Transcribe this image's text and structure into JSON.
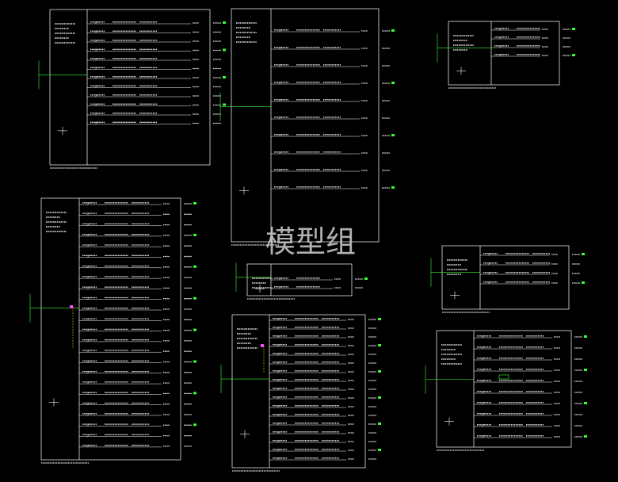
{
  "watermark": "模型组",
  "colors": {
    "background": "#000000",
    "frame": "#ffffff",
    "wire": "#33ff33",
    "label": "#e8e8e8",
    "accent_yellow": "#ffd800",
    "accent_magenta": "#ff44ff"
  },
  "panels": [
    {
      "id": "panel-a",
      "circuits": 12
    },
    {
      "id": "panel-b",
      "circuits": 10
    },
    {
      "id": "panel-c",
      "circuits": 4
    },
    {
      "id": "panel-d",
      "circuits": 24
    },
    {
      "id": "panel-e",
      "circuits": 2
    },
    {
      "id": "panel-f",
      "circuits": 17
    },
    {
      "id": "panel-g",
      "circuits": 4
    },
    {
      "id": "panel-h",
      "circuits": 10
    }
  ]
}
